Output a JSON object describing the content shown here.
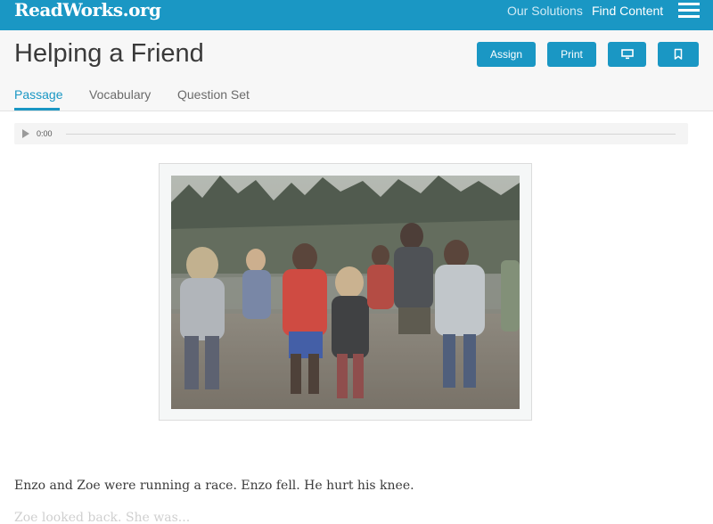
{
  "topbar": {
    "logo": "ReadWorks.org",
    "nav": {
      "solutions": "Our Solutions",
      "find_content": "Find Content"
    },
    "colors": {
      "brand": "#1a97c4"
    }
  },
  "header": {
    "title": "Helping a Friend",
    "buttons": {
      "assign": "Assign",
      "print": "Print",
      "present_icon": "monitor-icon",
      "bookmark_icon": "bookmark-icon"
    },
    "tabs": [
      {
        "label": "Passage",
        "active": true
      },
      {
        "label": "Vocabulary",
        "active": false
      },
      {
        "label": "Question Set",
        "active": false
      }
    ]
  },
  "audio": {
    "time": "0:00",
    "progress": 0
  },
  "passage": {
    "lines": [
      "Enzo and Zoe were running a race. Enzo fell. He hurt his knee.",
      "Zoe looked back. She was..."
    ]
  }
}
